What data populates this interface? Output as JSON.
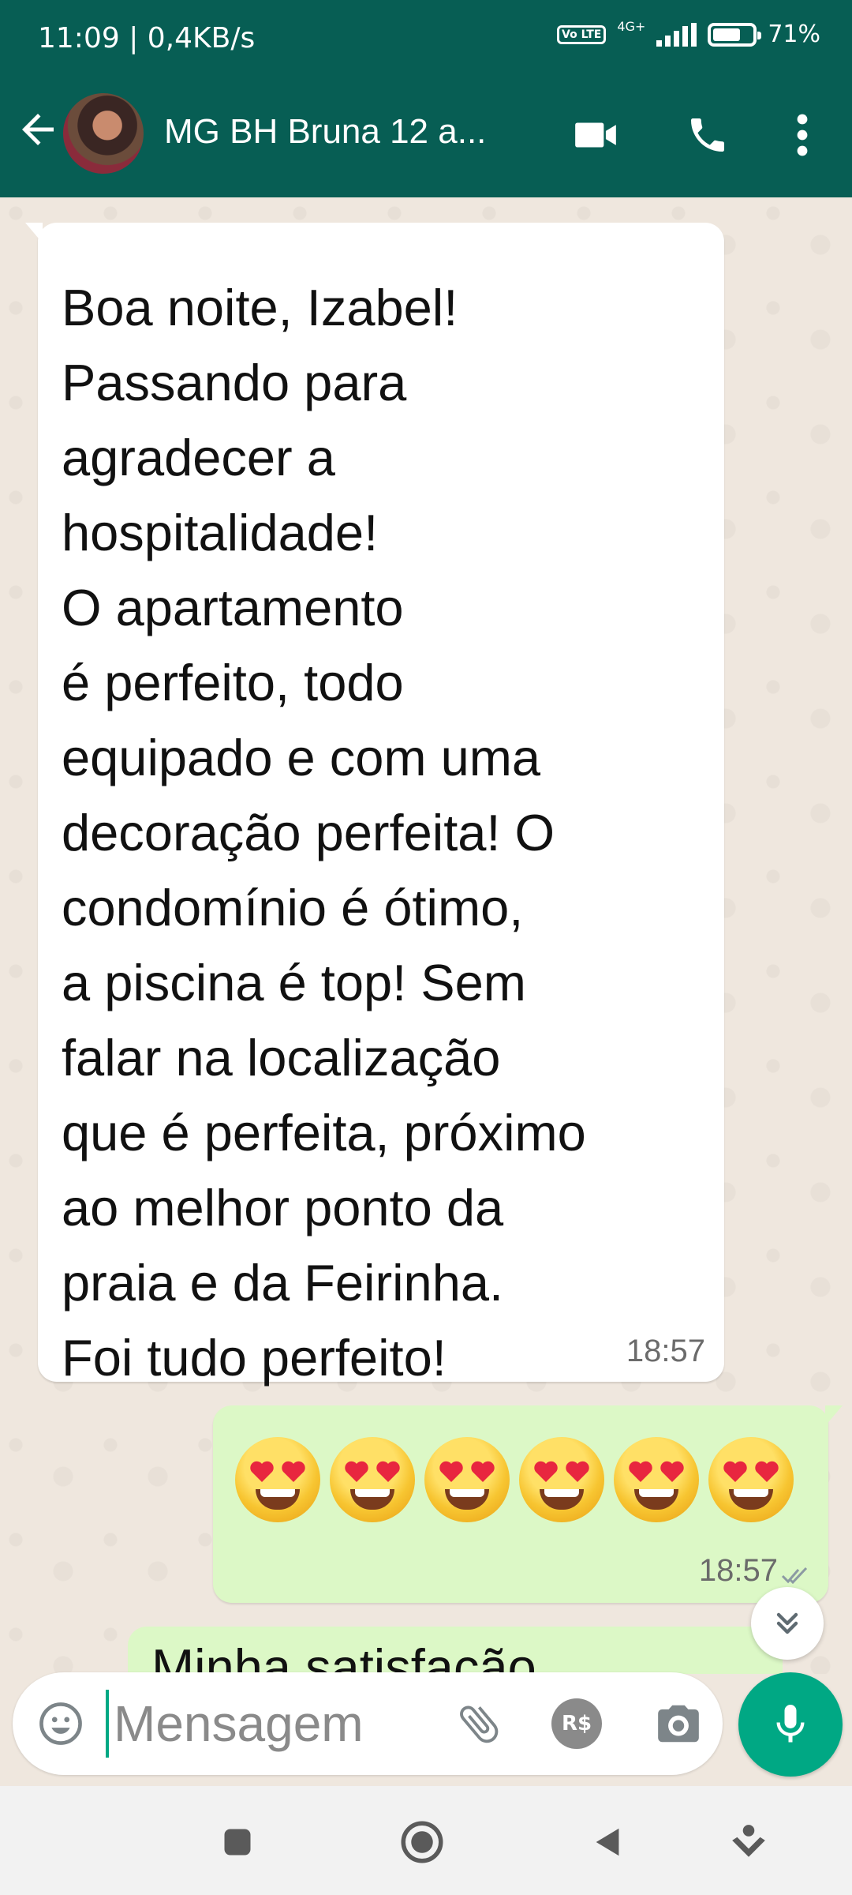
{
  "status_bar": {
    "time_speed": "11:09 | 0,4KB/s",
    "volte": "Vo LTE",
    "network": "4G+",
    "battery_level": 0.71,
    "battery_text": "71%"
  },
  "header": {
    "back_icon": "arrow-left-icon",
    "title": "MG BH Bruna 12 a...",
    "icons": [
      "video-call-icon",
      "phone-icon",
      "more-vert-icon"
    ]
  },
  "messages": {
    "incoming": {
      "text": "Boa noite, Izabel!\nPassando para\nagradecer a\nhospitalidade!\nO apartamento\né perfeito, todo\nequipado e com uma\ndecoração perfeita! O\ncondomínio é ótimo,\na piscina é top! Sem\nfalar na localização\nque é perfeita, próximo\nao melhor ponto da\npraia e da Feirinha.\nFoi tudo perfeito!",
      "time": "18:57"
    },
    "outgoing": {
      "emoji_name": "heart-eyes-emoji",
      "emoji_count": 6,
      "time": "18:57",
      "status_icon": "double-check-icon"
    },
    "partial": {
      "text": "Minha satisfação"
    }
  },
  "input": {
    "placeholder": "Mensagem",
    "pay_label": "R$",
    "icons": [
      "emoji-icon",
      "attach-icon",
      "camera-icon",
      "mic-icon"
    ]
  },
  "colors": {
    "header": "#075e54",
    "accent": "#00a884",
    "outgoing_bubble": "#dcf8c6",
    "incoming_bubble": "#ffffff",
    "chat_background": "#efe7de"
  }
}
